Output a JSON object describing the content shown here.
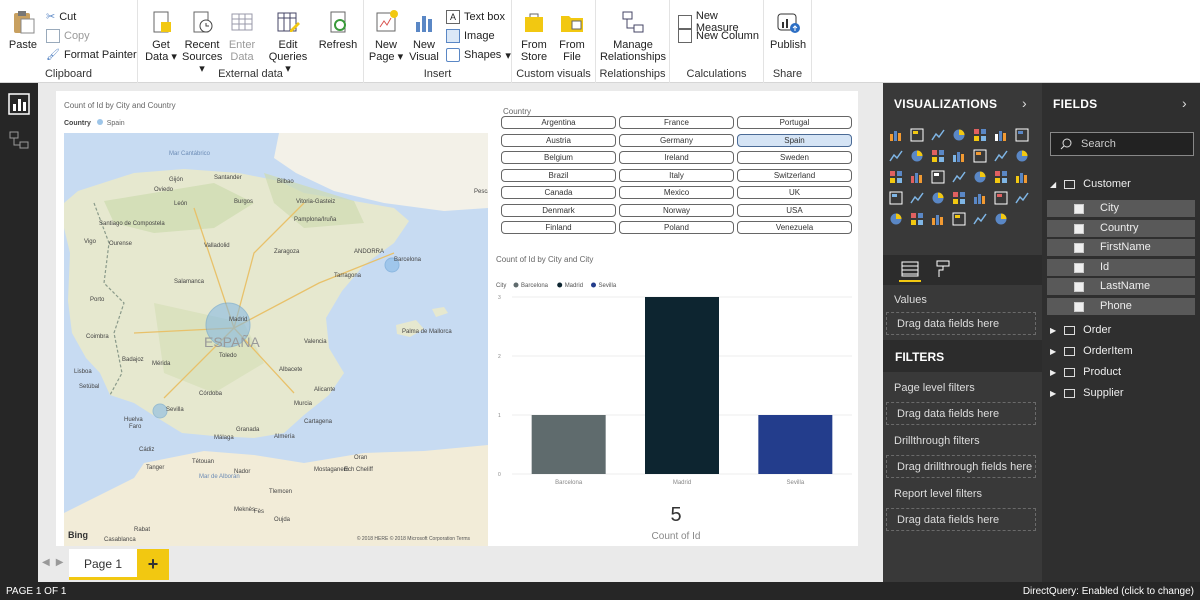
{
  "ribbon": {
    "clipboard": {
      "paste": "Paste",
      "cut": "Cut",
      "copy": "Copy",
      "format_painter": "Format Painter",
      "group": "Clipboard"
    },
    "external_data": {
      "get_data": "Get Data",
      "recent_sources": "Recent Sources",
      "enter_data": "Enter Data",
      "edit_queries": "Edit Queries",
      "refresh": "Refresh",
      "group": "External data"
    },
    "insert": {
      "new_page": "New Page",
      "new_visual": "New Visual",
      "text_box": "Text box",
      "image": "Image",
      "shapes": "Shapes",
      "group": "Insert"
    },
    "custom_visuals": {
      "from_store": "From Store",
      "from_file": "From File",
      "group": "Custom visuals"
    },
    "relationships": {
      "manage": "Manage Relationships",
      "group": "Relationships"
    },
    "calculations": {
      "new_measure": "New Measure",
      "new_column": "New Column",
      "group": "Calculations"
    },
    "share": {
      "publish": "Publish",
      "group": "Share"
    }
  },
  "map_visual": {
    "title": "Count of Id by City and Country",
    "legend_label": "Country",
    "legend_item": "Spain",
    "attribution": "Bing",
    "map_labels": [
      "Mar Cantábrico",
      "Gijón",
      "Santander",
      "Bilbao",
      "Oviedo",
      "León",
      "Burgos",
      "Vitoria-Gasteiz",
      "Pamplona/Iruña",
      "Santiago de Compostela",
      "Vigo",
      "Ourense",
      "Valladolid",
      "Zaragoza",
      "Barcelona",
      "Tarragona",
      "Salamanca",
      "Madrid",
      "ESPAÑA",
      "Toledo",
      "Valencia",
      "Palma de Mallorca",
      "Mérida",
      "Badajoz",
      "Albacete",
      "Alicante",
      "Murcia",
      "Córdoba",
      "Sevilla",
      "Granada",
      "Málaga",
      "Almería",
      "Cartagena",
      "Porto",
      "Coimbra",
      "Lisboa",
      "Setúbal",
      "Faro",
      "Huelva",
      "Cádiz",
      "Tanger",
      "Tétouan",
      "Oran",
      "Ech Cheliff",
      "Mostaganem",
      "Tlemcen",
      "Nador",
      "Fès",
      "Meknès",
      "Oujda",
      "Rabat",
      "Casablanca",
      "Mar de Alborán",
      "ANDORRA",
      "Pescara"
    ],
    "copyright": "© 2018 HERE © 2018 Microsoft Corporation Terms"
  },
  "slicer": {
    "title": "Country",
    "items": [
      "Argentina",
      "France",
      "Portugal",
      "Austria",
      "Germany",
      "Spain",
      "Belgium",
      "Ireland",
      "Sweden",
      "Brazil",
      "Italy",
      "Switzerland",
      "Canada",
      "Mexico",
      "UK",
      "Denmark",
      "Norway",
      "USA",
      "Finland",
      "Poland",
      "Venezuela"
    ],
    "selected": "Spain"
  },
  "bar_visual": {
    "title": "Count of Id by City and City",
    "legend_label": "City"
  },
  "chart_data": {
    "type": "bar",
    "title": "Count of Id by City and City",
    "categories": [
      "Barcelona",
      "Madrid",
      "Sevilla"
    ],
    "values": [
      1,
      3,
      1
    ],
    "colors": [
      "#5f6b6d",
      "#0d2530",
      "#233d8c"
    ],
    "legend": [
      "Barcelona",
      "Madrid",
      "Sevilla"
    ],
    "ylim": [
      0,
      3
    ],
    "yticks": [
      "0",
      "1",
      "2",
      "3"
    ],
    "grid": true,
    "legend_position": "top-left"
  },
  "card": {
    "value": "5",
    "label": "Count of Id"
  },
  "tabs": {
    "page1": "Page 1",
    "add": "+"
  },
  "visualizations": {
    "header": "VISUALIZATIONS",
    "values_label": "Values",
    "drop_hint": "Drag data fields here"
  },
  "filters": {
    "header": "FILTERS",
    "page_level": "Page level filters",
    "page_drop": "Drag data fields here",
    "drillthrough": "Drillthrough filters",
    "drill_drop": "Drag drillthrough fields here",
    "report_level": "Report level filters",
    "report_drop": "Drag data fields here"
  },
  "fields": {
    "header": "FIELDS",
    "search_placeholder": "Search",
    "tables": [
      "Customer",
      "Order",
      "OrderItem",
      "Product",
      "Supplier"
    ],
    "customer_fields": [
      "City",
      "Country",
      "FirstName",
      "Id",
      "LastName",
      "Phone"
    ]
  },
  "status": {
    "page": "PAGE 1 OF 1",
    "directquery": "DirectQuery: Enabled (click to change)"
  },
  "colors": {
    "accent": "#f2c811",
    "pane_dark": "#393939",
    "fields_dark": "#2f2f2f"
  }
}
